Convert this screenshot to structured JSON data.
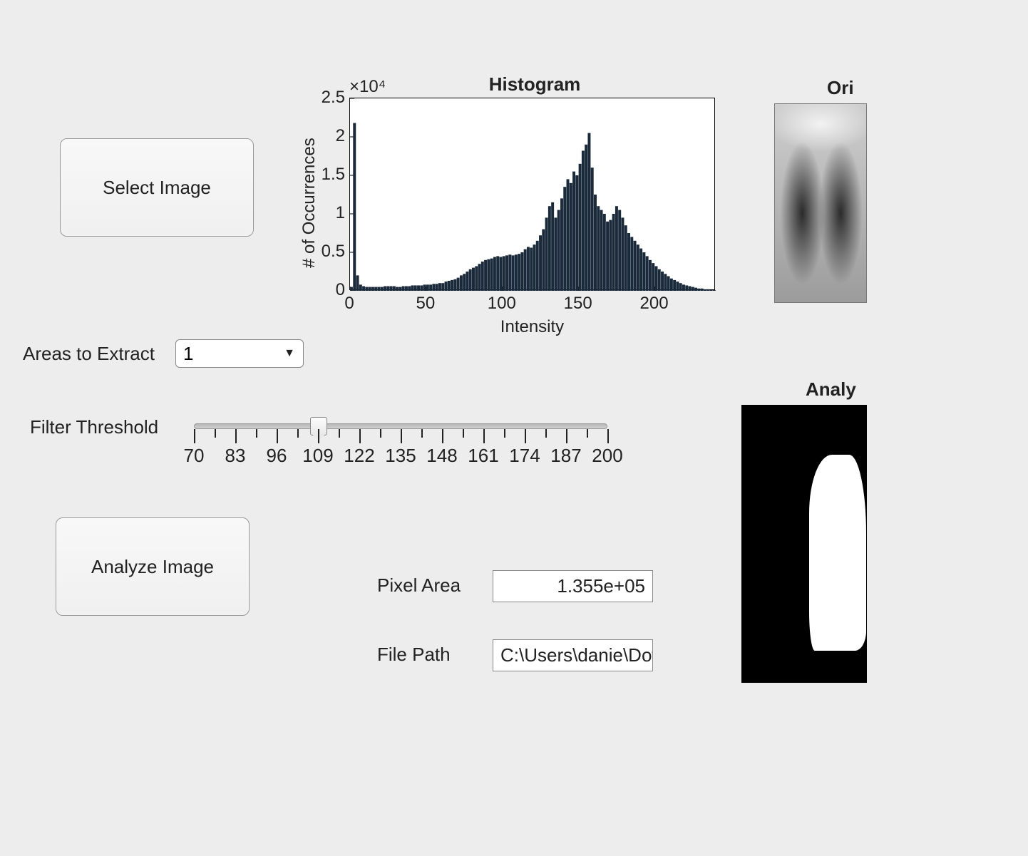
{
  "buttons": {
    "select_image": "Select Image",
    "analyze_image": "Analyze Image"
  },
  "controls": {
    "areas_label": "Areas to Extract",
    "areas_value": "1",
    "threshold_label": "Filter Threshold",
    "threshold_value": 109
  },
  "output": {
    "pixel_area_label": "Pixel Area",
    "pixel_area_value": "1.355e+05",
    "file_path_label": "File Path",
    "file_path_value": "C:\\Users\\danie\\Dow"
  },
  "right_titles": {
    "original_partial": "Ori",
    "analysis_partial": "Analy"
  },
  "slider_ticks": [
    70,
    83,
    96,
    109,
    122,
    135,
    148,
    161,
    174,
    187,
    200
  ],
  "chart_data": {
    "type": "bar",
    "title": "Histogram",
    "xlabel": "Intensity",
    "ylabel": "# of Occurrences",
    "y_exponent_label": "×10⁴",
    "xlim": [
      0,
      240
    ],
    "ylim": [
      0,
      2.5
    ],
    "xticks": [
      0,
      50,
      100,
      150,
      200
    ],
    "yticks": [
      0,
      0.5,
      1,
      1.5,
      2,
      2.5
    ],
    "x": [
      0,
      2,
      4,
      6,
      8,
      10,
      12,
      14,
      16,
      18,
      20,
      22,
      24,
      26,
      28,
      30,
      32,
      34,
      36,
      38,
      40,
      42,
      44,
      46,
      48,
      50,
      52,
      54,
      56,
      58,
      60,
      62,
      64,
      66,
      68,
      70,
      72,
      74,
      76,
      78,
      80,
      82,
      84,
      86,
      88,
      90,
      92,
      94,
      96,
      98,
      100,
      102,
      104,
      106,
      108,
      110,
      112,
      114,
      116,
      118,
      120,
      122,
      124,
      126,
      128,
      130,
      132,
      134,
      136,
      138,
      140,
      142,
      144,
      146,
      148,
      150,
      152,
      154,
      156,
      158,
      160,
      162,
      164,
      166,
      168,
      170,
      172,
      174,
      176,
      178,
      180,
      182,
      184,
      186,
      188,
      190,
      192,
      194,
      196,
      198,
      200,
      202,
      204,
      206,
      208,
      210,
      212,
      214,
      216,
      218,
      220,
      222,
      224,
      226,
      228,
      230,
      232,
      234,
      236,
      238
    ],
    "values": [
      0.05,
      2.18,
      0.2,
      0.08,
      0.06,
      0.05,
      0.05,
      0.05,
      0.05,
      0.05,
      0.05,
      0.06,
      0.06,
      0.06,
      0.06,
      0.05,
      0.05,
      0.06,
      0.06,
      0.06,
      0.07,
      0.07,
      0.07,
      0.07,
      0.08,
      0.08,
      0.08,
      0.09,
      0.09,
      0.1,
      0.1,
      0.12,
      0.13,
      0.14,
      0.15,
      0.17,
      0.2,
      0.22,
      0.25,
      0.28,
      0.3,
      0.32,
      0.35,
      0.38,
      0.4,
      0.41,
      0.42,
      0.44,
      0.45,
      0.44,
      0.45,
      0.46,
      0.47,
      0.46,
      0.47,
      0.48,
      0.5,
      0.54,
      0.57,
      0.56,
      0.6,
      0.65,
      0.72,
      0.8,
      0.95,
      1.1,
      1.15,
      0.95,
      1.05,
      1.2,
      1.35,
      1.45,
      1.4,
      1.55,
      1.5,
      1.65,
      1.82,
      1.9,
      2.05,
      1.6,
      1.25,
      1.1,
      1.05,
      1.0,
      0.9,
      0.92,
      1.0,
      1.1,
      1.05,
      0.95,
      0.85,
      0.75,
      0.7,
      0.65,
      0.6,
      0.55,
      0.5,
      0.45,
      0.4,
      0.36,
      0.32,
      0.28,
      0.25,
      0.22,
      0.19,
      0.16,
      0.14,
      0.12,
      0.1,
      0.08,
      0.07,
      0.06,
      0.05,
      0.04,
      0.03,
      0.03,
      0.02,
      0.02,
      0.01,
      0.01
    ]
  }
}
